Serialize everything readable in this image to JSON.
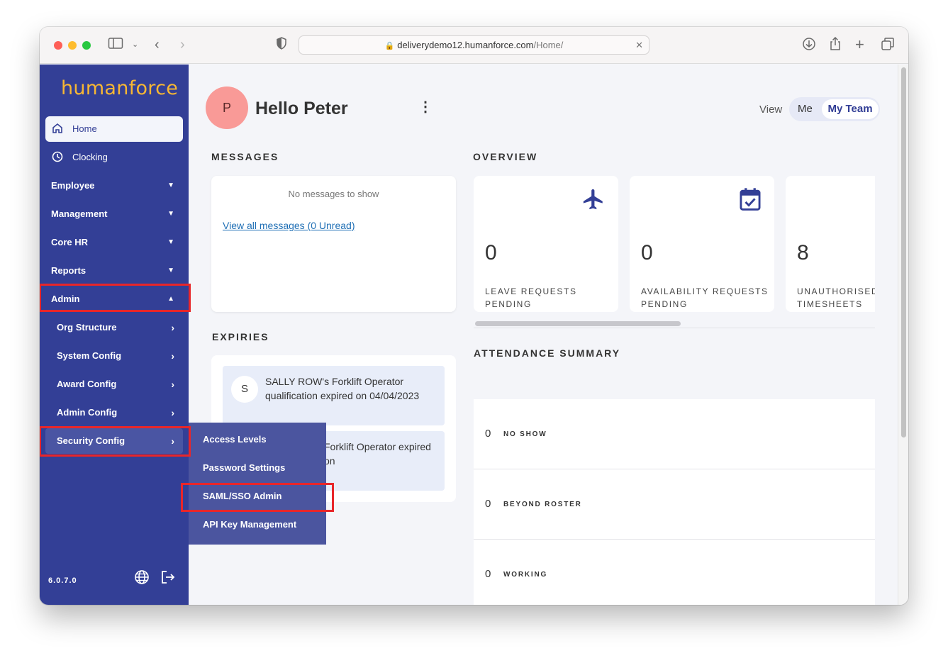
{
  "browser": {
    "url_domain": "deliverydemo12.humanforce.com",
    "url_path": "/Home/"
  },
  "sidebar": {
    "logo": "humanforce",
    "items": [
      {
        "label": "Home",
        "icon": "home-icon"
      },
      {
        "label": "Clocking",
        "icon": "clock-icon"
      },
      {
        "label": "Employee"
      },
      {
        "label": "Management"
      },
      {
        "label": "Core HR"
      },
      {
        "label": "Reports"
      },
      {
        "label": "Admin"
      }
    ],
    "admin_sub": [
      {
        "label": "Org Structure"
      },
      {
        "label": "System Config"
      },
      {
        "label": "Award Config"
      },
      {
        "label": "Admin Config"
      },
      {
        "label": "Security Config"
      }
    ],
    "version": "6.0.7.0"
  },
  "flyout": {
    "items": [
      {
        "label": "Access Levels"
      },
      {
        "label": "Password Settings"
      },
      {
        "label": "SAML/SSO Admin"
      },
      {
        "label": "API Key Management"
      }
    ]
  },
  "header": {
    "avatar_initial": "P",
    "greeting": "Hello Peter",
    "view_label": "View",
    "view_me": "Me",
    "view_team": "My Team"
  },
  "messages": {
    "title": "MESSAGES",
    "empty": "No messages to show",
    "link": "View all messages (0 Unread)"
  },
  "overview": {
    "title": "OVERVIEW",
    "cards": [
      {
        "value": "0",
        "label_line1": "LEAVE REQUESTS",
        "label_line2": "PENDING",
        "icon": "airplane-icon"
      },
      {
        "value": "0",
        "label_line1": "AVAILABILITY REQUESTS",
        "label_line2": "PENDING",
        "icon": "calendar-check-icon"
      },
      {
        "value": "8",
        "label_line1": "UNAUTHORISED",
        "label_line2": "TIMESHEETS"
      }
    ]
  },
  "expiries": {
    "title": "EXPIRIES",
    "items": [
      {
        "initial": "S",
        "text": "SALLY ROW's Forklift Operator qualification expired on 04/04/2023"
      },
      {
        "text": "Forklift Operator expired on"
      }
    ]
  },
  "attendance": {
    "title": "ATTENDANCE SUMMARY",
    "rows": [
      {
        "value": "0",
        "label": "NO SHOW"
      },
      {
        "value": "0",
        "label": "BEYOND ROSTER"
      },
      {
        "value": "0",
        "label": "WORKING"
      }
    ]
  }
}
